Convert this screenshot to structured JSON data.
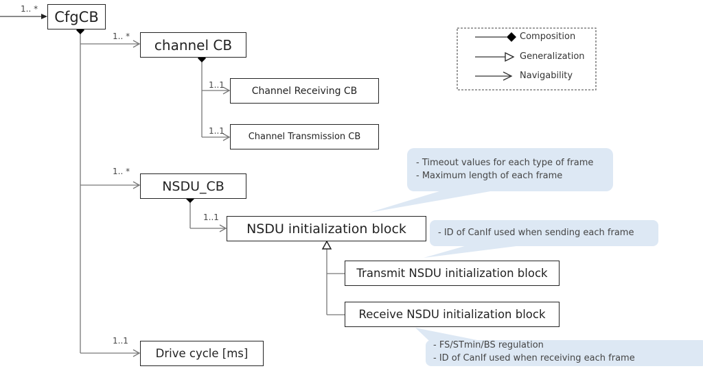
{
  "blocks": {
    "cfgcb": "CfgCB",
    "channel_cb": "channel CB",
    "channel_receiving_cb": "Channel Receiving CB",
    "channel_transmission_cb": "Channel Transmission CB",
    "nsdu_cb": "NSDU_CB",
    "nsdu_init_block": "NSDU initialization block",
    "transmit_nsdu_init_block": "Transmit NSDU initialization block",
    "receive_nsdu_init_block": "Receive NSDU initialization block",
    "drive_cycle": "Drive cycle [ms]"
  },
  "multiplicities": {
    "cfgcb_in": "1.. *",
    "channel_cb": "1.. *",
    "channel_receiving": "1..1",
    "channel_transmission": "1..1",
    "nsdu_cb": "1.. *",
    "nsdu_init": "1..1",
    "drive_cycle": "1..1"
  },
  "legend": {
    "composition": "Composition",
    "generalization": "Generalization",
    "navigability": "Navigability"
  },
  "callouts": {
    "nsdu_init": [
      "- Timeout values for each type of frame",
      "- Maximum length of each frame"
    ],
    "transmit": [
      "- ID of CanIf used when sending each frame"
    ],
    "receive": [
      "- FS/STmin/BS regulation",
      "- ID of CanIf used when receiving each frame"
    ]
  },
  "colors": {
    "callout_fill": "#dde8f4",
    "line": "#777777",
    "box_border": "#222222"
  }
}
